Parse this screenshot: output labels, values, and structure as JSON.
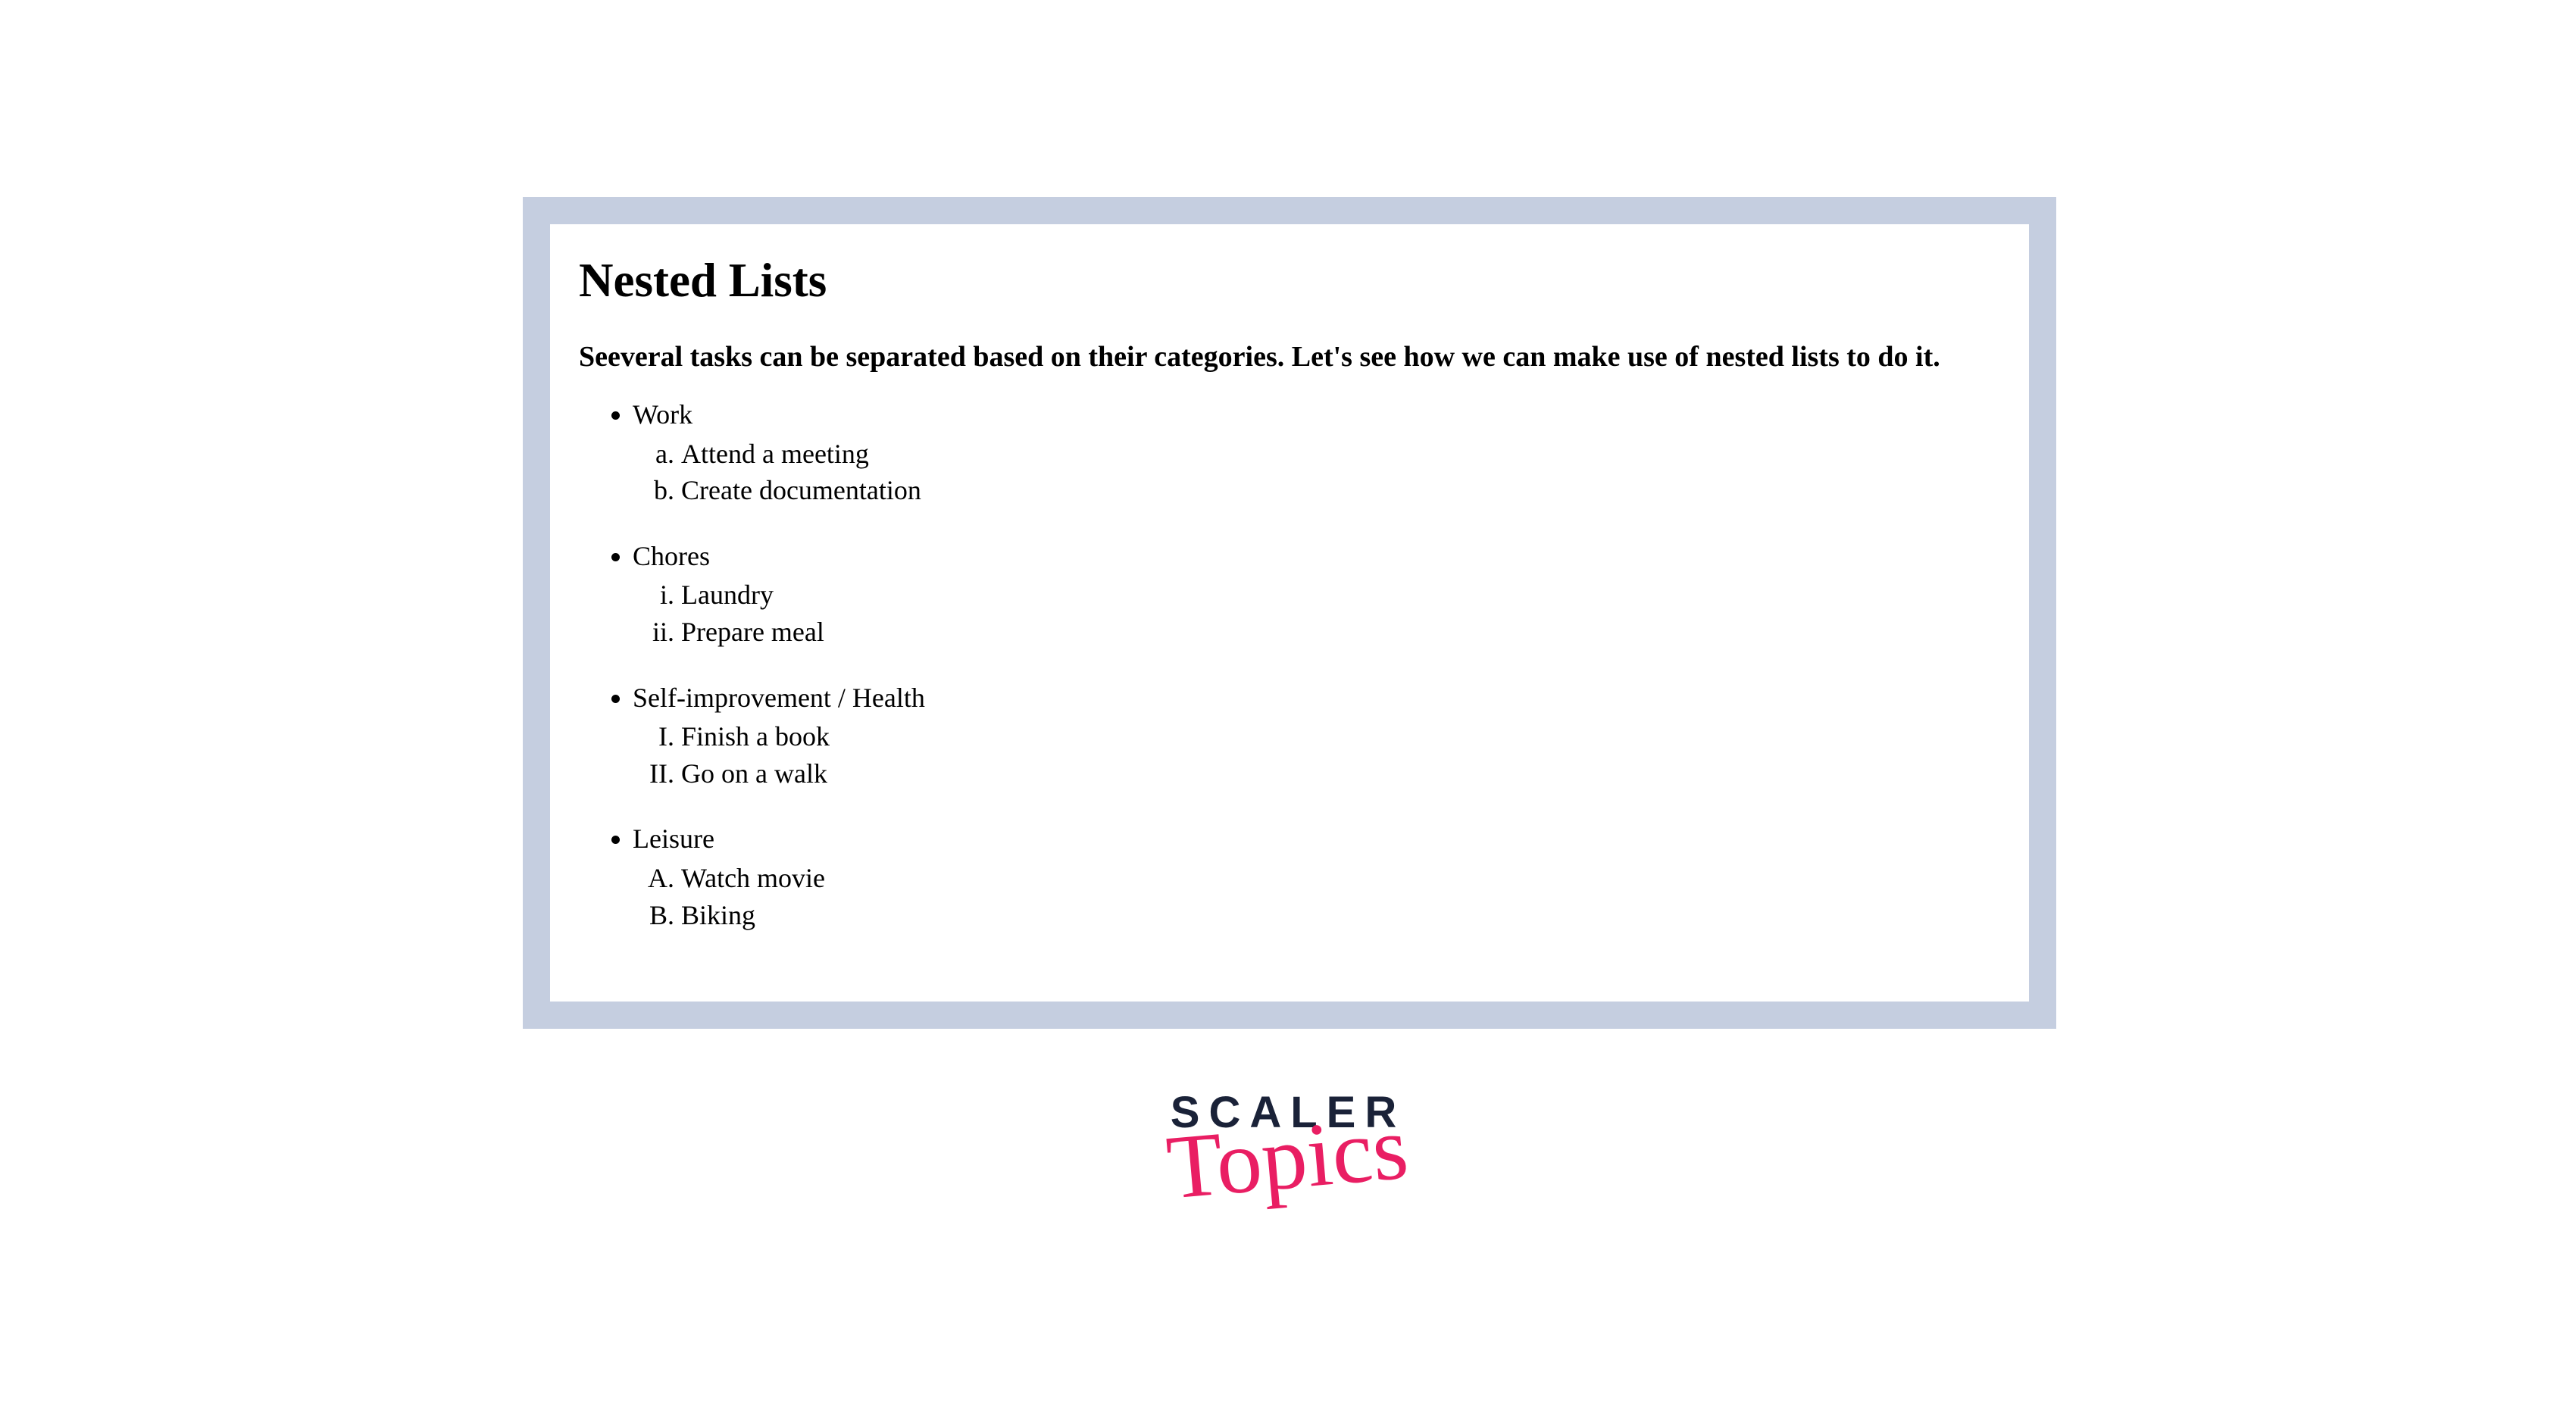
{
  "heading": "Nested Lists",
  "subtitle": "Seeveral tasks can be separated based on their categories. Let's see how we can make use of nested lists to do it.",
  "categories": [
    {
      "name": "Work",
      "items": [
        "Attend a meeting",
        "Create documentation"
      ]
    },
    {
      "name": "Chores",
      "items": [
        "Laundry",
        "Prepare meal"
      ]
    },
    {
      "name": "Self-improvement / Health",
      "items": [
        "Finish a book",
        "Go on a walk"
      ]
    },
    {
      "name": "Leisure",
      "items": [
        "Watch movie",
        "Biking"
      ]
    }
  ],
  "logo": {
    "line1": "SCALER",
    "line2": "Topics"
  }
}
